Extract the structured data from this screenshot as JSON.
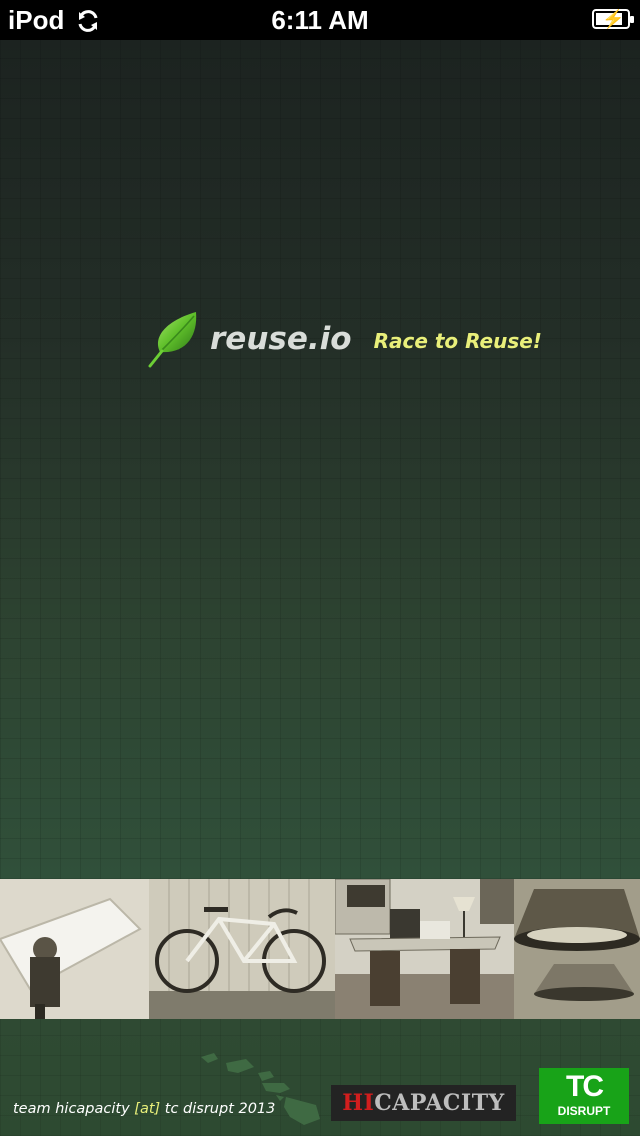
{
  "status_bar": {
    "device": "iPod",
    "time": "6:11 AM"
  },
  "app": {
    "logo_text": "reuse.io",
    "tagline": "Race to Reuse!",
    "accent_color": "#e9ef7a",
    "leaf_color": "#5fbf2a"
  },
  "photos": [
    {
      "icon": "mattress-photo"
    },
    {
      "icon": "bicycle-photo"
    },
    {
      "icon": "desk-photo"
    },
    {
      "icon": "lamp-photo"
    }
  ],
  "footer": {
    "text_prefix": "team hicapacity ",
    "text_at": "[at]",
    "text_suffix": " tc disrupt 2013",
    "hicapacity_hi": "HI",
    "hicapacity_rest": "CAPACITY",
    "tc_logo_big": "TC",
    "tc_logo_small": "DISRUPT"
  }
}
